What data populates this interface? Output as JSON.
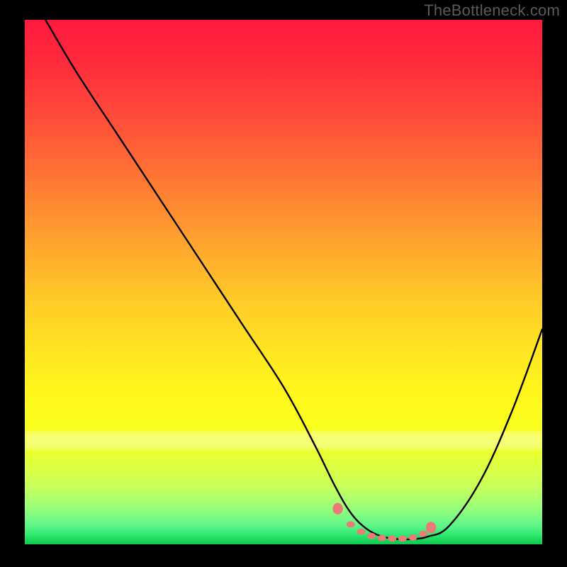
{
  "watermark": "TheBottleneck.com",
  "colors": {
    "background": "#000000",
    "curve_stroke": "#000000",
    "marker_fill": "#ec7a77",
    "watermark_color": "#5a5a5a"
  },
  "chart_data": {
    "type": "line",
    "title": "",
    "xlabel": "",
    "ylabel": "",
    "x_range": [
      0,
      100
    ],
    "y_range": [
      0,
      100
    ],
    "series": [
      {
        "name": "bottleneck-curve",
        "x": [
          4,
          10,
          18,
          26,
          34,
          42,
          50,
          56,
          60,
          63,
          66,
          69,
          72,
          75,
          78,
          82,
          88,
          94,
          100
        ],
        "y": [
          100,
          90,
          78,
          66,
          54,
          42,
          30,
          19,
          11,
          6,
          3,
          1.5,
          1,
          1,
          1.5,
          3.5,
          12,
          25,
          41
        ]
      }
    ],
    "markers": {
      "name": "highlight-band",
      "x": [
        60.5,
        63,
        65,
        67,
        69,
        71,
        73,
        75,
        77,
        78.5
      ],
      "y": [
        6.8,
        3.8,
        2.4,
        1.6,
        1.2,
        1.1,
        1.1,
        1.3,
        2.0,
        3.2
      ]
    },
    "gradient_scale": {
      "top_color": "#ff1a3e",
      "bottom_color": "#0fc94f",
      "meaning": "red=high, green=low"
    }
  }
}
